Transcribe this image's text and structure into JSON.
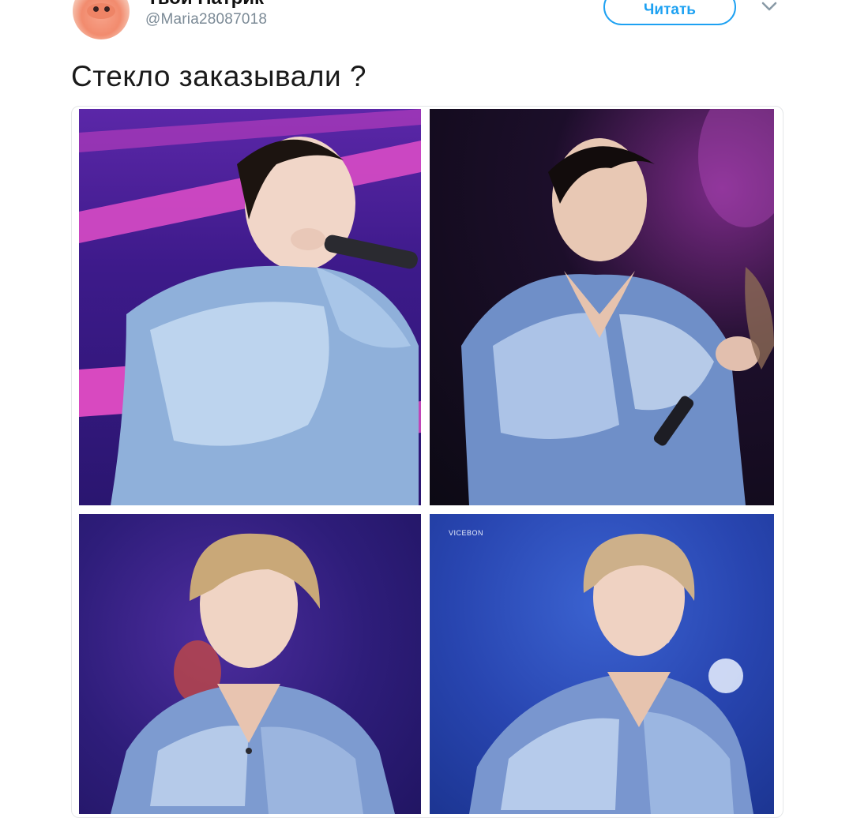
{
  "tweet": {
    "display_name": "Твой Патрик",
    "handle": "@Maria28087018",
    "follow_label": "Читать",
    "text": "Стекло заказывали ?"
  },
  "media": {
    "photo_watermark": "VICEBON"
  },
  "colors": {
    "accent": "#1da1f2",
    "handle_gray": "#7b8a96"
  },
  "icons": {
    "more": "chevron-down-icon"
  }
}
